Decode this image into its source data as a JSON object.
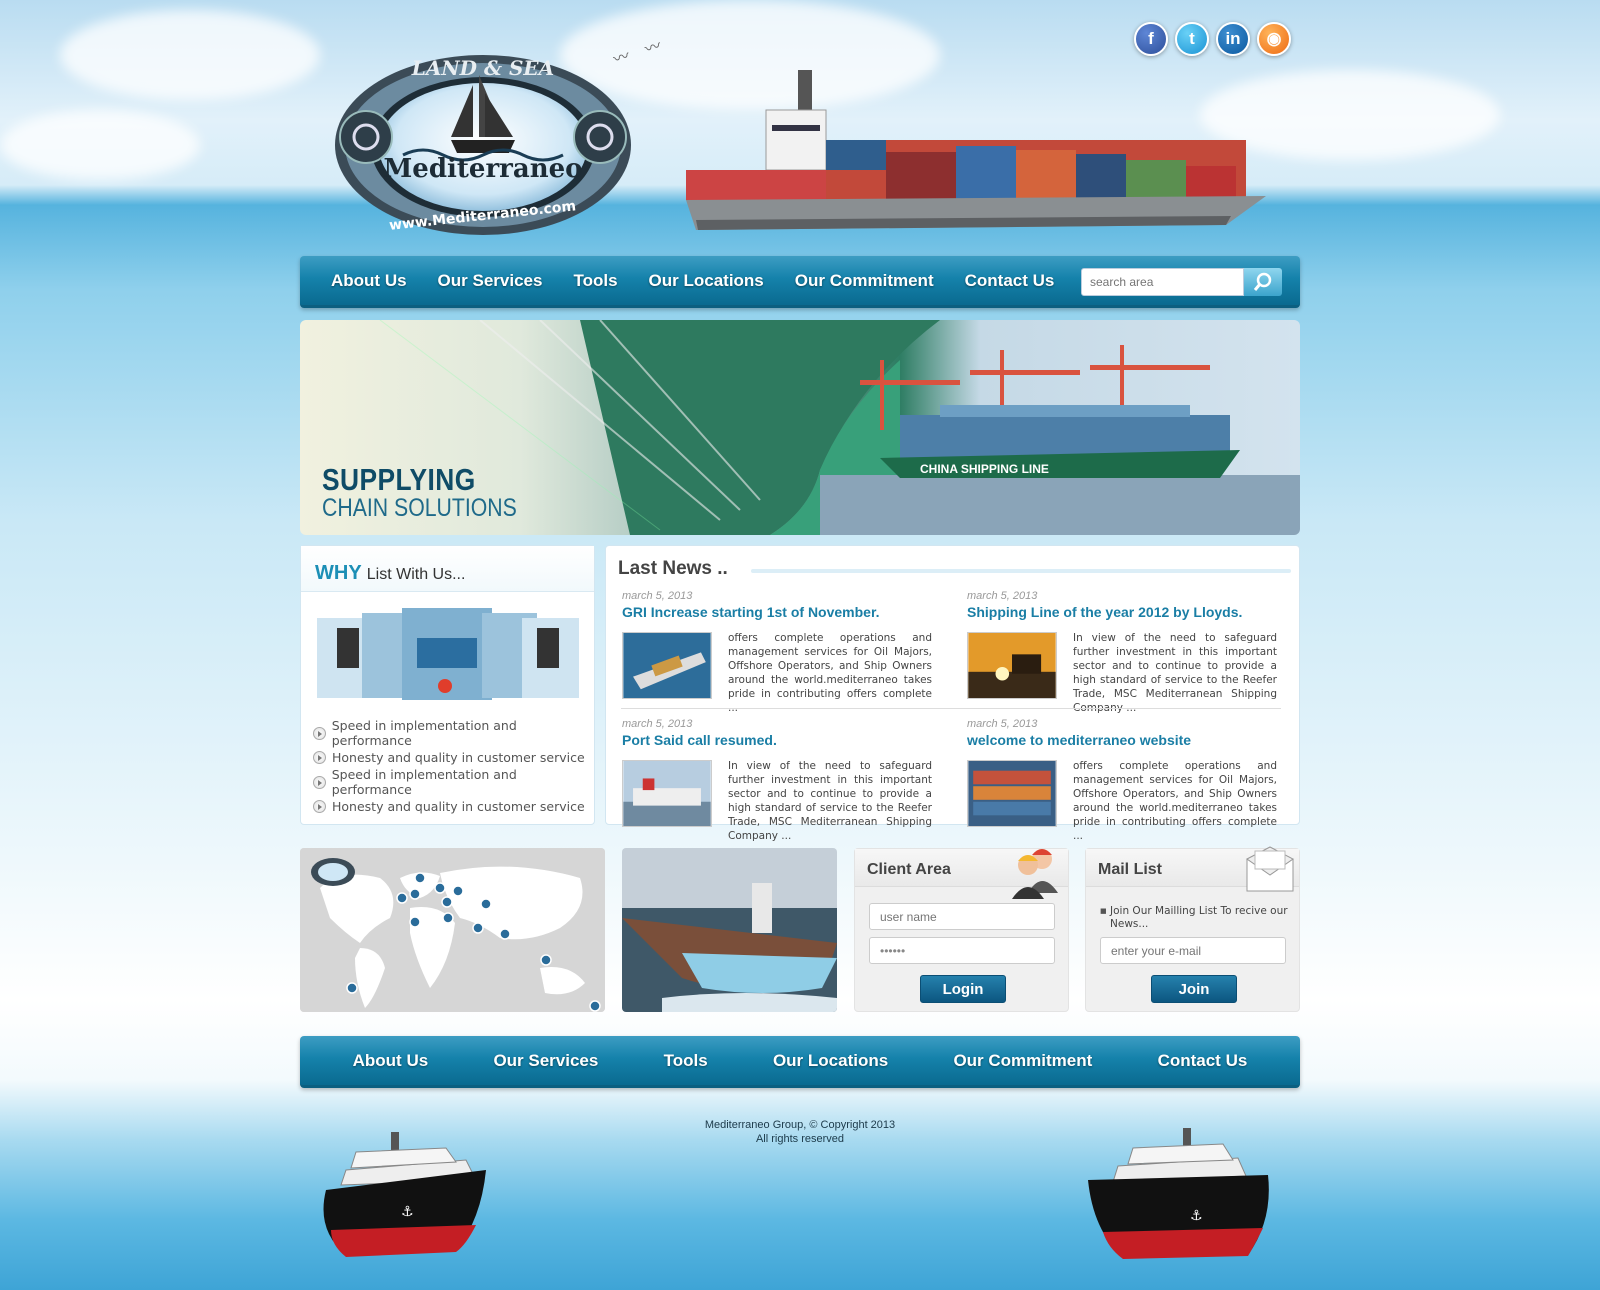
{
  "social": [
    "facebook-icon",
    "twitter-icon",
    "linkedin-icon",
    "rss-icon"
  ],
  "logo": {
    "top_text": "LAND & SEA",
    "name": "Mediterraneo",
    "url": "www.Mediterraneo.com"
  },
  "nav": {
    "items": [
      "About Us",
      "Our Services",
      "Tools",
      "Our Locations",
      "Our Commitment",
      "Contact Us"
    ],
    "search_placeholder": "search area"
  },
  "banner": {
    "line1": "SUPPLYING",
    "line2": "CHAIN SOLUTIONS",
    "ship_label": "CHINA SHIPPING LINE"
  },
  "why": {
    "title_bold": "WHY",
    "title_rest": "List With Us...",
    "items": [
      "Speed in implementation and performance",
      "Honesty and quality in customer service",
      "Speed in implementation and performance",
      "Honesty and quality in customer service"
    ]
  },
  "news": {
    "title": "Last News ..",
    "items": [
      {
        "date": "march 5, 2013",
        "title": "GRI Increase starting 1st of November.",
        "text": "offers complete operations and management services for Oil Majors, Offshore Operators, and Ship Owners around the world.mediterraneo takes pride in contributing offers complete ..."
      },
      {
        "date": "march 5, 2013",
        "title": "Shipping Line of the year 2012 by Lloyds.",
        "text": "In view of the need to safeguard further investment in this important sector and to continue to provide a high standard of service to the Reefer Trade, MSC Mediterranean Shipping Company ..."
      },
      {
        "date": "march 5, 2013",
        "title": "Port Said call resumed.",
        "text": "In view of the need to safeguard further investment in this important sector and to continue to provide a high standard of service to the Reefer Trade, MSC Mediterranean Shipping Company ..."
      },
      {
        "date": "march 5, 2013",
        "title": "welcome to mediterraneo website",
        "text": "offers complete operations and management services for Oil Majors, Offshore Operators, and Ship Owners around the world.mediterraneo takes pride in contributing offers complete ..."
      }
    ]
  },
  "client": {
    "title": "Client Area",
    "user_placeholder": "user name",
    "pass_value": "●●●●●●",
    "button": "Login"
  },
  "mail": {
    "title": "Mail List",
    "note": "Join Our Mailling List To recive our News...",
    "email_placeholder": "enter your e-mail",
    "button": "Join"
  },
  "footer": {
    "line1": "Mediterraneo Group, © Copyright 2013",
    "line2": "All rights reserved"
  }
}
